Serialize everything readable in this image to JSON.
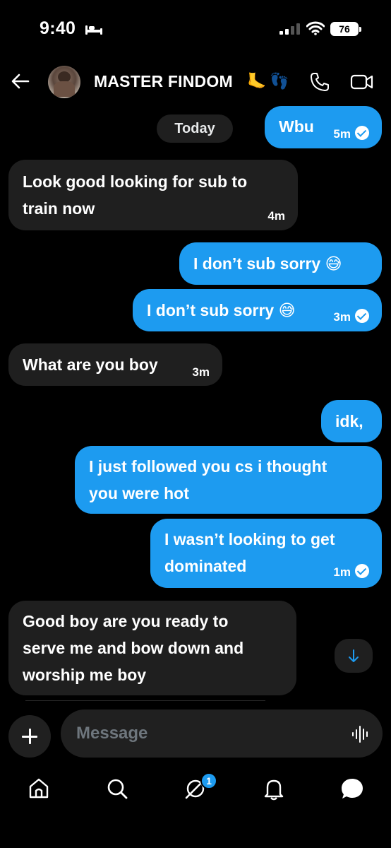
{
  "status_bar": {
    "time": "9:40",
    "battery": "76"
  },
  "header": {
    "contact_name": "MASTER FINDOM",
    "name_emojis": [
      "🦶",
      "👣"
    ]
  },
  "chat": {
    "date_separator": "Today",
    "messages": [
      {
        "side": "out",
        "lines": [
          "Wbu"
        ],
        "time": "5m",
        "read": true
      },
      {
        "side": "in",
        "lines": [
          "Look good looking for sub to",
          "train now"
        ],
        "time": "4m"
      },
      {
        "side": "out",
        "lines": [
          "I don’t sub sorry 😅"
        ],
        "time": ""
      },
      {
        "side": "out",
        "lines": [
          "I don’t sub sorry 😅"
        ],
        "time": "3m",
        "read": true
      },
      {
        "side": "in",
        "lines": [
          "What are you boy"
        ],
        "time": "3m"
      },
      {
        "side": "out",
        "lines": [
          "idk,"
        ],
        "time": ""
      },
      {
        "side": "out",
        "lines": [
          "I just followed you cs i thought",
          "you were hot"
        ],
        "time": ""
      },
      {
        "side": "out",
        "lines": [
          "I wasn’t looking to get",
          "dominated"
        ],
        "time": "1m",
        "read": true
      },
      {
        "side": "in",
        "lines": [
          "Good boy are you ready to",
          "serve me and bow down and",
          "worship me boy"
        ],
        "time": ""
      }
    ]
  },
  "composer": {
    "placeholder": "Message"
  },
  "tabbar": {
    "items": [
      "home-icon",
      "search-icon",
      "grok-icon",
      "notifications-icon",
      "messages-icon"
    ],
    "grok_badge": "1"
  },
  "colors": {
    "accent": "#1d9bf0",
    "incoming_bubble": "#1f1f1f",
    "background": "#000000"
  }
}
